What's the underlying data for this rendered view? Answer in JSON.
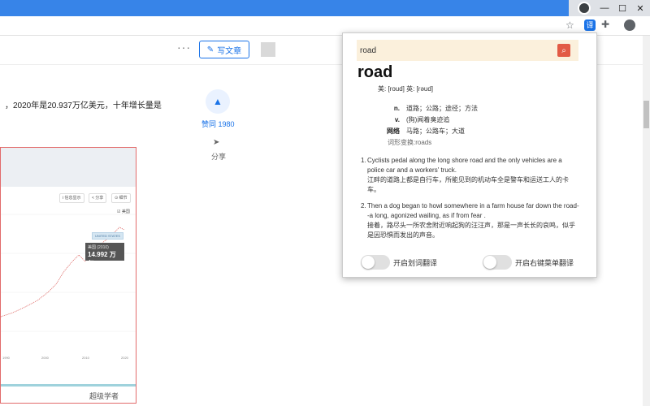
{
  "browser": {
    "window_controls": [
      "—",
      "☐",
      "✕"
    ],
    "toolbar_icons": [
      "star-icon",
      "translate-extension-icon",
      "puzzle-icon",
      "profile-avatar-icon"
    ]
  },
  "page": {
    "header": {
      "write_button_label": "写文章"
    },
    "body_text": "，2020年是20.937万亿美元，十年增长量是",
    "vote": {
      "label": "赞同 1980"
    },
    "share": {
      "label": "分享"
    },
    "chart_embed": {
      "buttons": [
        "i 信息显示",
        "< 分享",
        "⊙ 细节"
      ],
      "legend": "☑ 美国",
      "series_tag": "UNITED STATES",
      "tooltip_line1": "美国 (2010)",
      "tooltip_value": "14.992 万亿",
      "x_ticks": [
        "1990",
        "2000",
        "2010",
        "2020"
      ]
    },
    "watermark": "超级学者"
  },
  "dictionary_popup": {
    "search_value": "road",
    "headword": "road",
    "phonetic": "美: [roud]    英: [rəud]",
    "definitions": [
      {
        "pos": "n.",
        "text": "道路；公路；途径；方法"
      },
      {
        "pos": "v.",
        "text": "(狗)闻着臭迹追"
      },
      {
        "pos": "网络",
        "text": "马路；公路车；大道"
      }
    ],
    "word_forms": "词形变换:roads",
    "examples": [
      {
        "num": "1.",
        "en": "Cyclists pedal along the long shore road and the only vehicles are a police car and a workers' truck.",
        "zh": "江畔的道路上都是自行车，所能见到的机动车全是警车和运送工人的卡车。"
      },
      {
        "num": "2.",
        "en": "Then a dog began to howl somewhere in a farm house far down the road--a long, agonized wailing, as if from fear .",
        "zh": "接着，路尽头一所农舍附近响起狗的汪汪声，那是一声长长的哀鸣，似乎是因恐惧而发出的声音。"
      }
    ],
    "toggles": [
      {
        "label": "开启划词翻译"
      },
      {
        "label": "开启右键菜单翻译"
      }
    ]
  }
}
